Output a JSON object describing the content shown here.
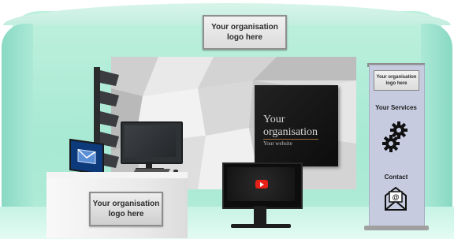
{
  "booth": {
    "top_logo": "Your organisation\nlogo here",
    "counter_logo": "Your organisation\nlogo here"
  },
  "poster": {
    "title": "Your\norganisation",
    "subtitle": "Your website"
  },
  "banner": {
    "logo": "Your organisation\nlogo here",
    "services": "Your Services",
    "contact": "Contact"
  },
  "colors": {
    "booth": "#a7e9d3",
    "banner": "#c6cbe0",
    "play_button": "#e62117"
  },
  "icons": [
    "gear-icon",
    "mail-icon",
    "play-icon",
    "envelope-icon"
  ]
}
